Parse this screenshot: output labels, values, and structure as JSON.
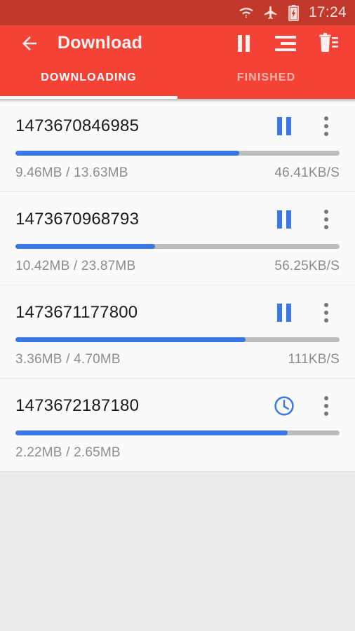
{
  "statusbar": {
    "time": "17:24",
    "icons": [
      "wifi-data-icon",
      "airplane-mode-icon",
      "battery-charging-icon"
    ]
  },
  "appbar": {
    "back_label": "back-arrow",
    "title": "Download",
    "actions": [
      {
        "name": "pause-all-button",
        "icon": "pause-icon"
      },
      {
        "name": "sort-button",
        "icon": "sort-lines-icon"
      },
      {
        "name": "delete-all-button",
        "icon": "trash-delete-icon"
      }
    ],
    "accent_color": "#f44336",
    "statusbar_color": "#c0392b"
  },
  "tabs": [
    {
      "label": "DOWNLOADING",
      "active": true
    },
    {
      "label": "FINISHED",
      "active": false
    }
  ],
  "downloads": [
    {
      "name": "1473670846985",
      "size_text": "9.46MB / 13.63MB",
      "speed": "46.41KB/S",
      "progress": 69,
      "state": "downloading",
      "state_icon": "pause-icon"
    },
    {
      "name": "1473670968793",
      "size_text": "10.42MB / 23.87MB",
      "speed": "56.25KB/S",
      "progress": 43,
      "state": "downloading",
      "state_icon": "pause-icon"
    },
    {
      "name": "1473671177800",
      "size_text": "3.36MB / 4.70MB",
      "speed": "111KB/S",
      "progress": 71,
      "state": "downloading",
      "state_icon": "pause-icon"
    },
    {
      "name": "1473672187180",
      "size_text": "2.22MB / 2.65MB",
      "speed": "",
      "progress": 84,
      "state": "pending",
      "state_icon": "clock-icon"
    }
  ],
  "colors": {
    "progress_fill": "#3b78e7",
    "progress_track": "#bdbdbd",
    "row_background": "#fafafa",
    "page_background": "#ececec"
  }
}
